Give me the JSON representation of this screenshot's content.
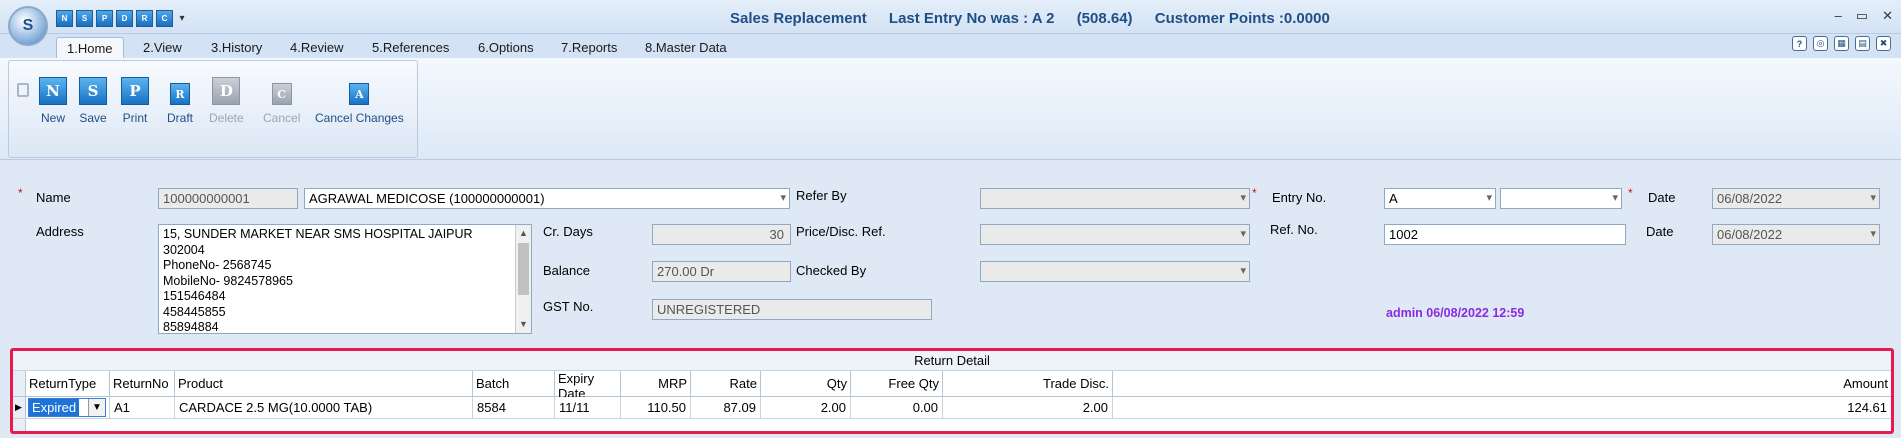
{
  "app": {
    "orb_letter": "S",
    "quick_access": [
      "N",
      "S",
      "P",
      "D",
      "R",
      "C"
    ],
    "title": "Sales Replacement",
    "last_entry": "Last Entry No was : A 2",
    "last_amount": "(508.64)",
    "customer_points": "Customer Points :0.0000",
    "window_controls": {
      "minimize": "–",
      "maximize": "▭",
      "close": "✕"
    }
  },
  "tabs": [
    {
      "label": "1.Home",
      "active": true
    },
    {
      "label": "2.View"
    },
    {
      "label": "3.History"
    },
    {
      "label": "4.Review"
    },
    {
      "label": "5.References"
    },
    {
      "label": "6.Options"
    },
    {
      "label": "7.Reports"
    },
    {
      "label": "8.Master Data"
    }
  ],
  "ribbon": {
    "buttons": [
      {
        "label": "New",
        "glyph": "N",
        "enabled": true
      },
      {
        "label": "Save",
        "glyph": "S",
        "enabled": true
      },
      {
        "label": "Print",
        "glyph": "P",
        "enabled": true
      },
      {
        "label": "Draft",
        "glyph": "R",
        "enabled": true
      },
      {
        "label": "Delete",
        "glyph": "D",
        "enabled": false
      },
      {
        "label": "Cancel",
        "glyph": "C",
        "enabled": false
      },
      {
        "label": "Cancel Changes",
        "glyph": "A",
        "enabled": true
      }
    ]
  },
  "form": {
    "name_label": "Name",
    "name_code": "100000000001",
    "name_value": "AGRAWAL MEDICOSE (100000000001)",
    "address_label": "Address",
    "address_lines": [
      "15, SUNDER MARKET NEAR SMS HOSPITAL JAIPUR",
      "302004",
      "PhoneNo- 2568745",
      "MobileNo- 9824578965",
      "151546484",
      "458445855",
      "85894884"
    ],
    "cr_days_label": "Cr. Days",
    "cr_days_value": "30",
    "balance_label": "Balance",
    "balance_value": "270.00 Dr",
    "gst_label": "GST No.",
    "gst_value": "UNREGISTERED",
    "refer_by_label": "Refer By",
    "price_ref_label": "Price/Disc. Ref.",
    "checked_by_label": "Checked By",
    "entry_no_label": "Entry No.",
    "entry_no_series": "A",
    "ref_no_label": "Ref. No.",
    "ref_no_value": "1002",
    "date_label": "Date",
    "date_value": "06/08/2022",
    "date2_label": "Date",
    "date2_value": "06/08/2022",
    "audit": "admin 06/08/2022 12:59"
  },
  "grid": {
    "caption": "Return Detail",
    "columns": [
      "ReturnType",
      "ReturnNo",
      "Product",
      "Batch",
      "Expiry Date",
      "MRP",
      "Rate",
      "Qty",
      "Free Qty",
      "Trade Disc.",
      "Amount"
    ],
    "rows": [
      {
        "return_type": "Expired",
        "return_no": "A1",
        "product": "CARDACE 2.5 MG(10.0000 TAB)",
        "batch": "8584",
        "expiry": "11/11",
        "mrp": "110.50",
        "rate": "87.09",
        "qty": "2.00",
        "free_qty": "0.00",
        "trade_disc": "2.00",
        "amount": "124.61"
      }
    ]
  },
  "colors": {
    "accent": "#1f4f86",
    "highlight_border": "#e8194f",
    "audit_text": "#8a2be2"
  }
}
